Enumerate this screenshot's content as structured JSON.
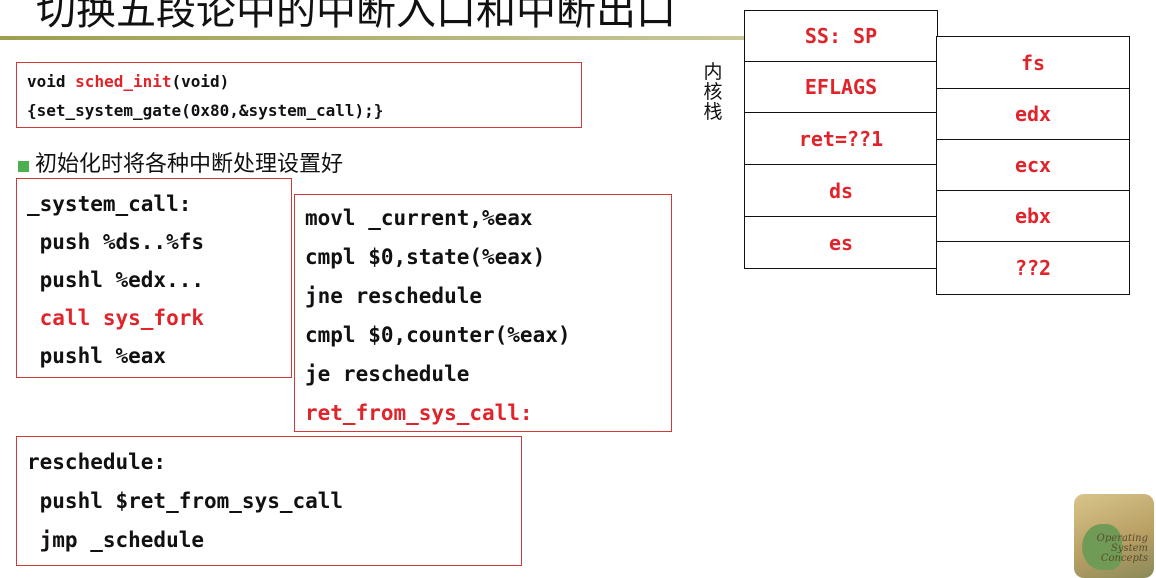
{
  "title": "切换五段论中的中断入口和中断出口",
  "init_box": {
    "line1_kw": "void ",
    "line1_fn": "sched_init",
    "line1_rest": "(void)",
    "line2": "{set_system_gate(0x80,&system_call);}"
  },
  "bullet_text": "初始化时将各种中断处理设置好",
  "system_call_box": {
    "lines": [
      "_system_call:",
      " push %ds..%fs",
      " pushl %edx...",
      " call sys_fork",
      " pushl %eax"
    ]
  },
  "continuation_box": {
    "lines": [
      "movl _current,%eax",
      "cmpl $0,state(%eax)",
      "jne reschedule",
      "cmpl $0,counter(%eax)",
      "je reschedule",
      "ret_from_sys_call:"
    ]
  },
  "reschedule_box": {
    "lines": [
      "reschedule:",
      " pushl $ret_from_sys_call",
      " jmp _schedule"
    ]
  },
  "kernel_stack_label": "内核栈",
  "kernel_stack_left": [
    "SS: SP",
    "EFLAGS",
    "ret=??1",
    "ds",
    "es"
  ],
  "kernel_stack_right": [
    "fs",
    "edx",
    "ecx",
    "ebx",
    "??2"
  ],
  "logo": {
    "text": [
      "Operating",
      "System",
      "Concepts"
    ]
  },
  "colors": {
    "highlight": "#e0242b",
    "box_border": "#d23a3a",
    "bullet": "#4caf50"
  }
}
